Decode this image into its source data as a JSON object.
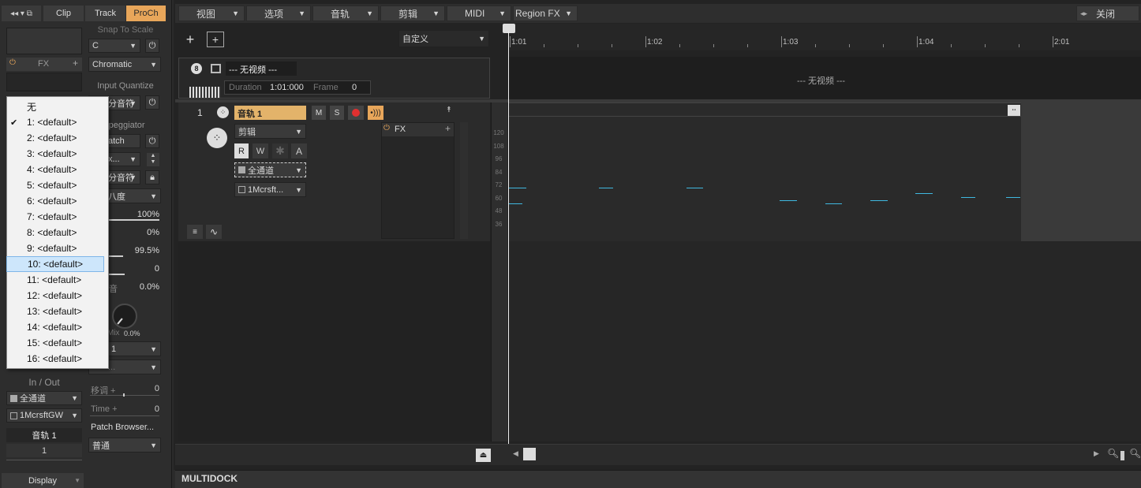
{
  "left_tabs": {
    "clip": "Clip",
    "track": "Track",
    "proch": "ProCh"
  },
  "fx_panel": {
    "fx_label": "FX",
    "plus": "+"
  },
  "prochannel": {
    "snap_to_scale": "Snap To Scale",
    "key": "C",
    "scale": "Chromatic",
    "input_quantize": "Input Quantize",
    "iq_value": "分音符",
    "arpeggiator": "rpeggiator",
    "latch": "atch",
    "arp_dd1": "x...",
    "arp_dd2": "分音符",
    "octave": "八度",
    "v1": "100%",
    "v2": "0%",
    "v3": "99.5%",
    "v4": "0",
    "v5_label": "音",
    "v5": "0.0%",
    "mix": "Mix",
    "mix_val": "0.0%",
    "dd_a": "1",
    "dd_b": "...",
    "transpose_label": "移调 +",
    "transpose_val": "0",
    "time_label": "Time +",
    "time_val": "0",
    "patch_browser": "Patch Browser...",
    "normal": "普通"
  },
  "inout": {
    "title": "In / Out",
    "input": "全通道",
    "output": "1McrsftGW",
    "track_name": "音轨 1",
    "track_num": "1"
  },
  "display_btn": "Display",
  "channel_menu": {
    "items": [
      "无",
      "1: <default>",
      "2: <default>",
      "3: <default>",
      "4: <default>",
      "5: <default>",
      "6: <default>",
      "7: <default>",
      "8: <default>",
      "9: <default>",
      "10: <default>",
      "11: <default>",
      "12: <default>",
      "13: <default>",
      "14: <default>",
      "15: <default>",
      "16: <default>"
    ],
    "checked_index": 1,
    "hover_index": 10
  },
  "top_menu": {
    "view": "视图",
    "options": "选项",
    "track": "音轨",
    "edit": "剪辑",
    "midi": "MIDI",
    "region_fx": "Region FX",
    "close": "关闭"
  },
  "toolbar": {
    "custom": "自定义"
  },
  "video_track": {
    "name": "--- 无视频 ---",
    "duration_label": "Duration",
    "duration_value": "1:01:000",
    "frame_label": "Frame",
    "frame_value": "0",
    "lane_text": "--- 无视频 ---"
  },
  "track1": {
    "number": "1",
    "name": "音轨 1",
    "m": "M",
    "s": "S",
    "edit_mode": "剪辑",
    "r": "R",
    "w": "W",
    "a": "A",
    "input": "全通道",
    "output": "1Mcrsft...",
    "fx": "FX"
  },
  "ruler": [
    "1:01",
    "1:02",
    "1:03",
    "1:04",
    "2:01"
  ],
  "velocity_labels": [
    "120",
    "108",
    "96",
    "84",
    "72",
    "60",
    "48",
    "36"
  ],
  "multidock": "MULTIDOCK",
  "colors": {
    "accent_orange": "#e8a65a",
    "track_name_bg": "#e3b36a",
    "note_color": "#3fb8e0",
    "menu_highlight": "#cde6fb"
  }
}
